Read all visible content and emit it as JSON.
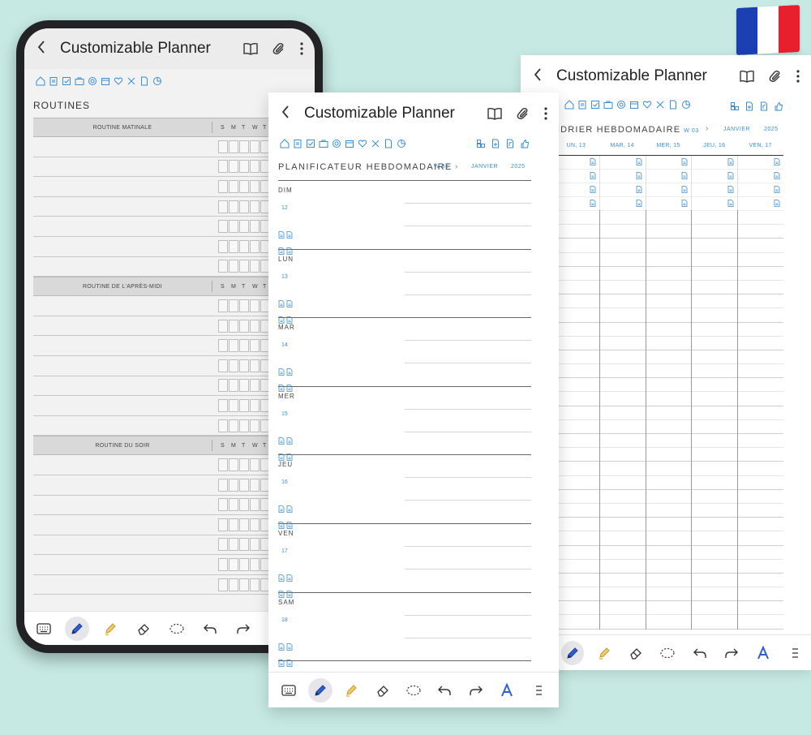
{
  "colors": {
    "accent": "#3b8fd4",
    "flag_blue": "#1d3fb4",
    "flag_white": "#ffffff",
    "flag_red": "#e8202e"
  },
  "phone": {
    "title": "Customizable Planner",
    "routines_title": "ROUTINES",
    "day_letters": [
      "S",
      "M",
      "T",
      "W",
      "T"
    ],
    "sections": [
      {
        "name": "ROUTINE MATINALE",
        "rows": 7
      },
      {
        "name": "ROUTINE DE L'APRÈS-MIDI",
        "rows": 7
      },
      {
        "name": "ROUTINE DU SOIR",
        "rows": 7
      }
    ]
  },
  "weekly": {
    "title": "Customizable Planner",
    "heading": "NDRIER HEBDOMADAIRE",
    "week": "W 03",
    "month": "JANVIER",
    "year": "2025",
    "columns": [
      "UN, 13",
      "MAR, 14",
      "MER, 15",
      "JEU, 16",
      "VEN, 17"
    ]
  },
  "daily": {
    "title": "Customizable Planner",
    "heading": "PLANIFICATEUR HEBDOMADAIRE",
    "week": "W 03",
    "month": "JANVIER",
    "year": "2025",
    "days": [
      {
        "name": "DIM",
        "num": "12"
      },
      {
        "name": "LUN",
        "num": "13"
      },
      {
        "name": "MAR",
        "num": "14"
      },
      {
        "name": "MER",
        "num": "15"
      },
      {
        "name": "JEU",
        "num": "16"
      },
      {
        "name": "VEN",
        "num": "17"
      },
      {
        "name": "SAM",
        "num": "18"
      }
    ]
  },
  "toolbar": {
    "tools": [
      "keyboard-icon",
      "pen-icon",
      "highlighter-icon",
      "eraser-icon",
      "lasso-icon",
      "undo-icon",
      "redo-icon",
      "text-style-icon",
      "more-tools-icon"
    ]
  }
}
